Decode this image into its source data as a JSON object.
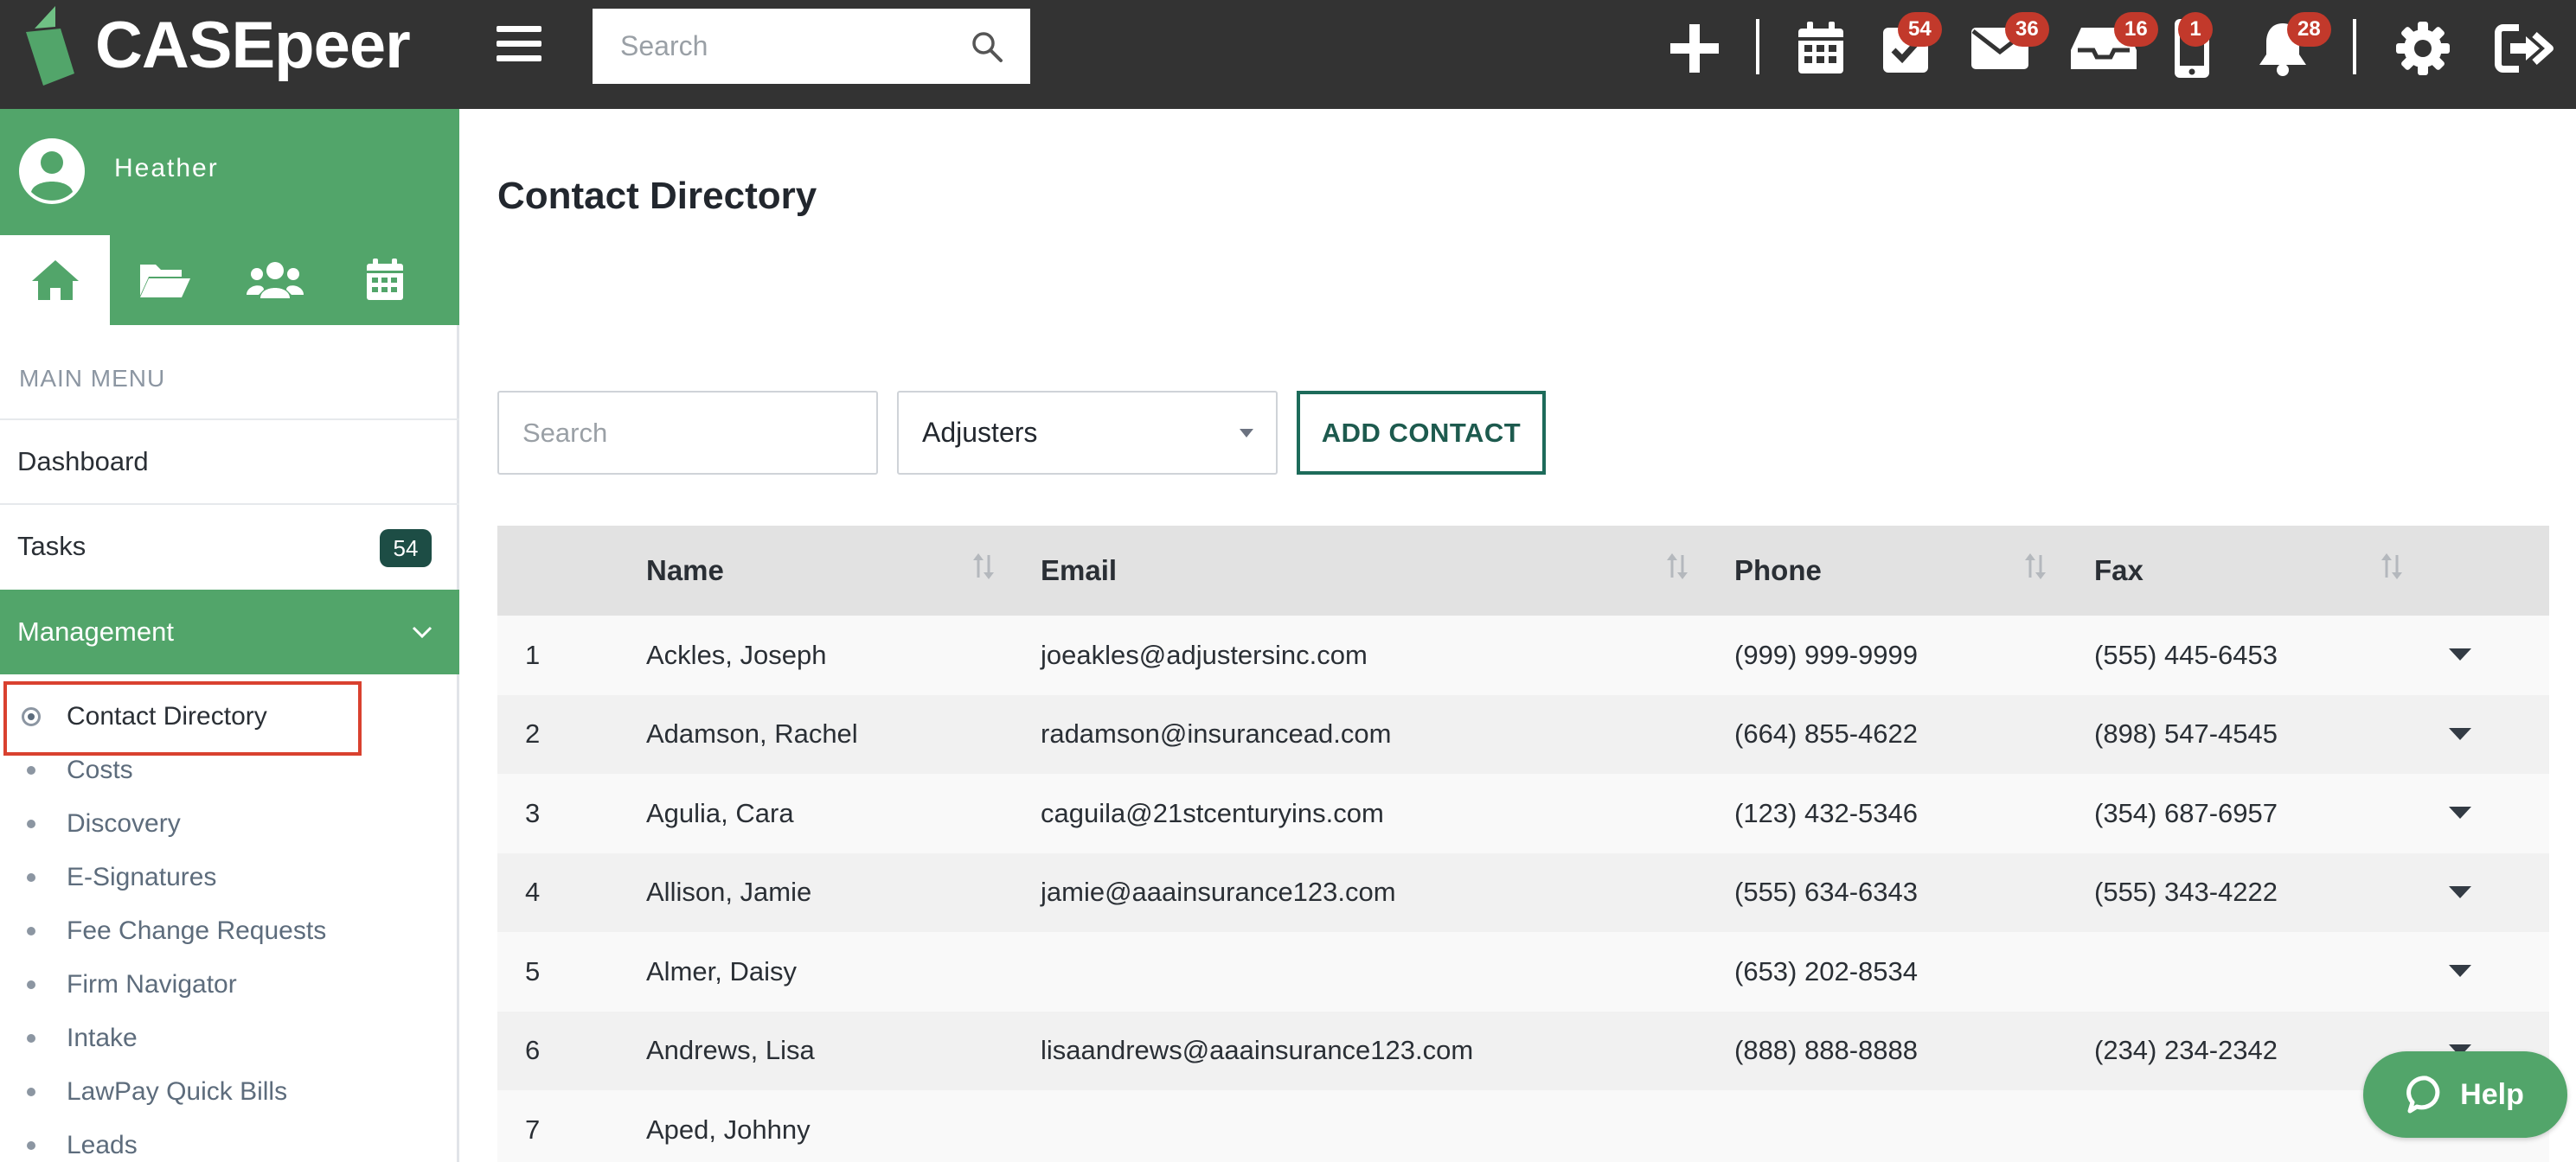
{
  "header": {
    "logo_text": "CASEpeer",
    "search_placeholder": "Search",
    "icons": {
      "add": "plus-icon",
      "calendar": "calendar-icon",
      "tasks": "task-check-icon",
      "mail": "mail-icon",
      "inbox": "inbox-icon",
      "phone": "mobile-phone-icon",
      "notifications": "bell-icon",
      "settings": "gear-icon",
      "logout": "logout-icon"
    },
    "badges": {
      "tasks": "54",
      "mail": "36",
      "inbox": "16",
      "phone": "1",
      "notifications": "28"
    }
  },
  "sidebar": {
    "user_name": "Heather",
    "menu_label": "MAIN MENU",
    "items": [
      {
        "label": "Dashboard"
      },
      {
        "label": "Tasks",
        "count": "54"
      },
      {
        "label": "Management"
      }
    ],
    "sub_items": [
      "Contact Directory",
      "Costs",
      "Discovery",
      "E-Signatures",
      "Fee Change Requests",
      "Firm Navigator",
      "Intake",
      "LawPay Quick Bills",
      "Leads"
    ]
  },
  "main": {
    "title": "Contact Directory",
    "search_placeholder": "Search",
    "filter_value": "Adjusters",
    "add_button": "ADD CONTACT",
    "columns": [
      "Name",
      "Email",
      "Phone",
      "Fax"
    ],
    "rows": [
      {
        "num": "1",
        "name": "Ackles, Joseph",
        "email": "joeakles@adjustersinc.com",
        "phone": "(999) 999-9999",
        "fax": "(555) 445-6453"
      },
      {
        "num": "2",
        "name": "Adamson, Rachel",
        "email": "radamson@insurancead.com",
        "phone": "(664) 855-4622",
        "fax": "(898) 547-4545"
      },
      {
        "num": "3",
        "name": "Agulia, Cara",
        "email": "caguila@21stcenturyins.com",
        "phone": "(123) 432-5346",
        "fax": "(354) 687-6957"
      },
      {
        "num": "4",
        "name": "Allison, Jamie",
        "email": "jamie@aaainsurance123.com",
        "phone": "(555) 634-6343",
        "fax": "(555) 343-4222"
      },
      {
        "num": "5",
        "name": "Almer, Daisy",
        "email": "",
        "phone": "(653) 202-8534",
        "fax": ""
      },
      {
        "num": "6",
        "name": "Andrews, Lisa",
        "email": "lisaandrews@aaainsurance123.com",
        "phone": "(888) 888-8888",
        "fax": "(234) 234-2342"
      },
      {
        "num": "7",
        "name": "Aped, Johhny",
        "email": "",
        "phone": "",
        "fax": ""
      }
    ]
  },
  "help": {
    "label": "Help"
  },
  "colors": {
    "topbar": "#333333",
    "brand_green": "#52a56a",
    "dark_green": "#1d4d45",
    "badge_red": "#c2392b",
    "highlight_red": "#d9412f"
  }
}
